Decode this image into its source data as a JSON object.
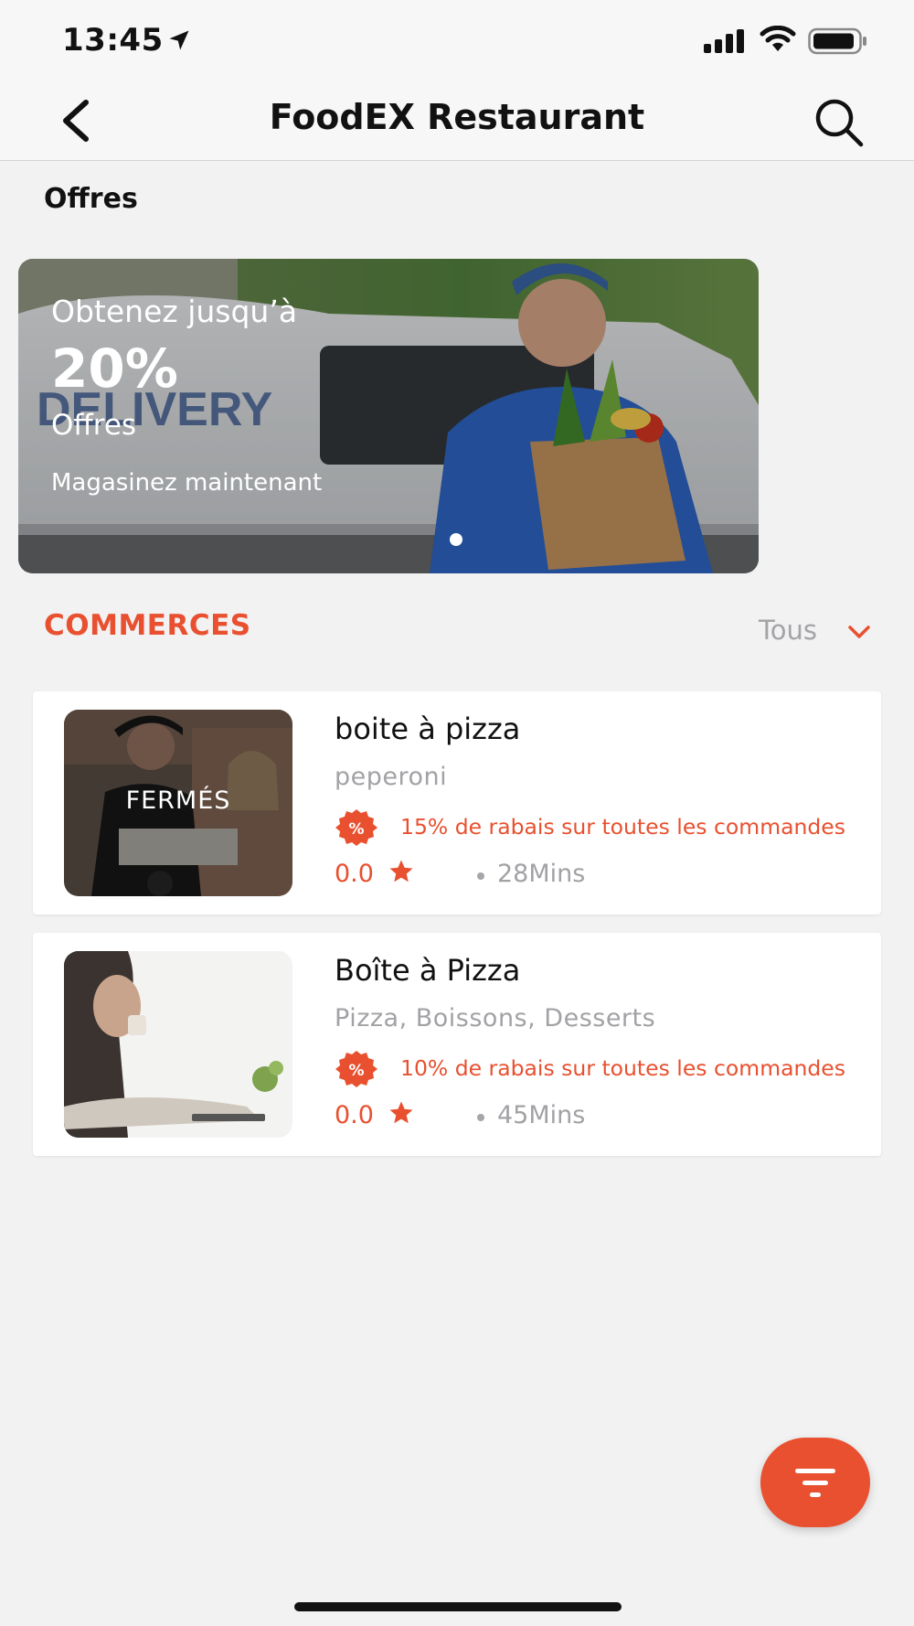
{
  "status_bar": {
    "time": "13:45",
    "icons": [
      "location-arrow-icon",
      "cellular-signal-icon",
      "wifi-icon",
      "battery-icon"
    ]
  },
  "nav": {
    "title": "FoodEX Restaurant",
    "back_icon": "chevron-left-icon",
    "search_icon": "search-icon"
  },
  "offers": {
    "section_title": "Offres",
    "banner": {
      "line1": "Obtenez jusqu’à",
      "percent": "20%",
      "line3": "Offres",
      "cta": "Magasinez maintenant",
      "image_text": "DELIVERY"
    }
  },
  "stores": {
    "section_title": "COMMERCES",
    "filter_value": "Tous",
    "items": [
      {
        "name": "boite à pizza",
        "cuisine": "peperoni",
        "promo": "15% de rabais sur toutes les commandes",
        "rating": "0.0",
        "time": "28Mins",
        "status_label": "FERMÉS"
      },
      {
        "name": "Boîte à Pizza",
        "cuisine": "Pizza, Boissons, Desserts",
        "promo": "10% de rabais sur toutes les commandes",
        "rating": "0.0",
        "time": "45Mins"
      }
    ]
  },
  "colors": {
    "accent": "#e8502f",
    "muted_text": "#a2a2a6",
    "background": "#f2f2f3"
  },
  "fab_icon": "filter-icon"
}
